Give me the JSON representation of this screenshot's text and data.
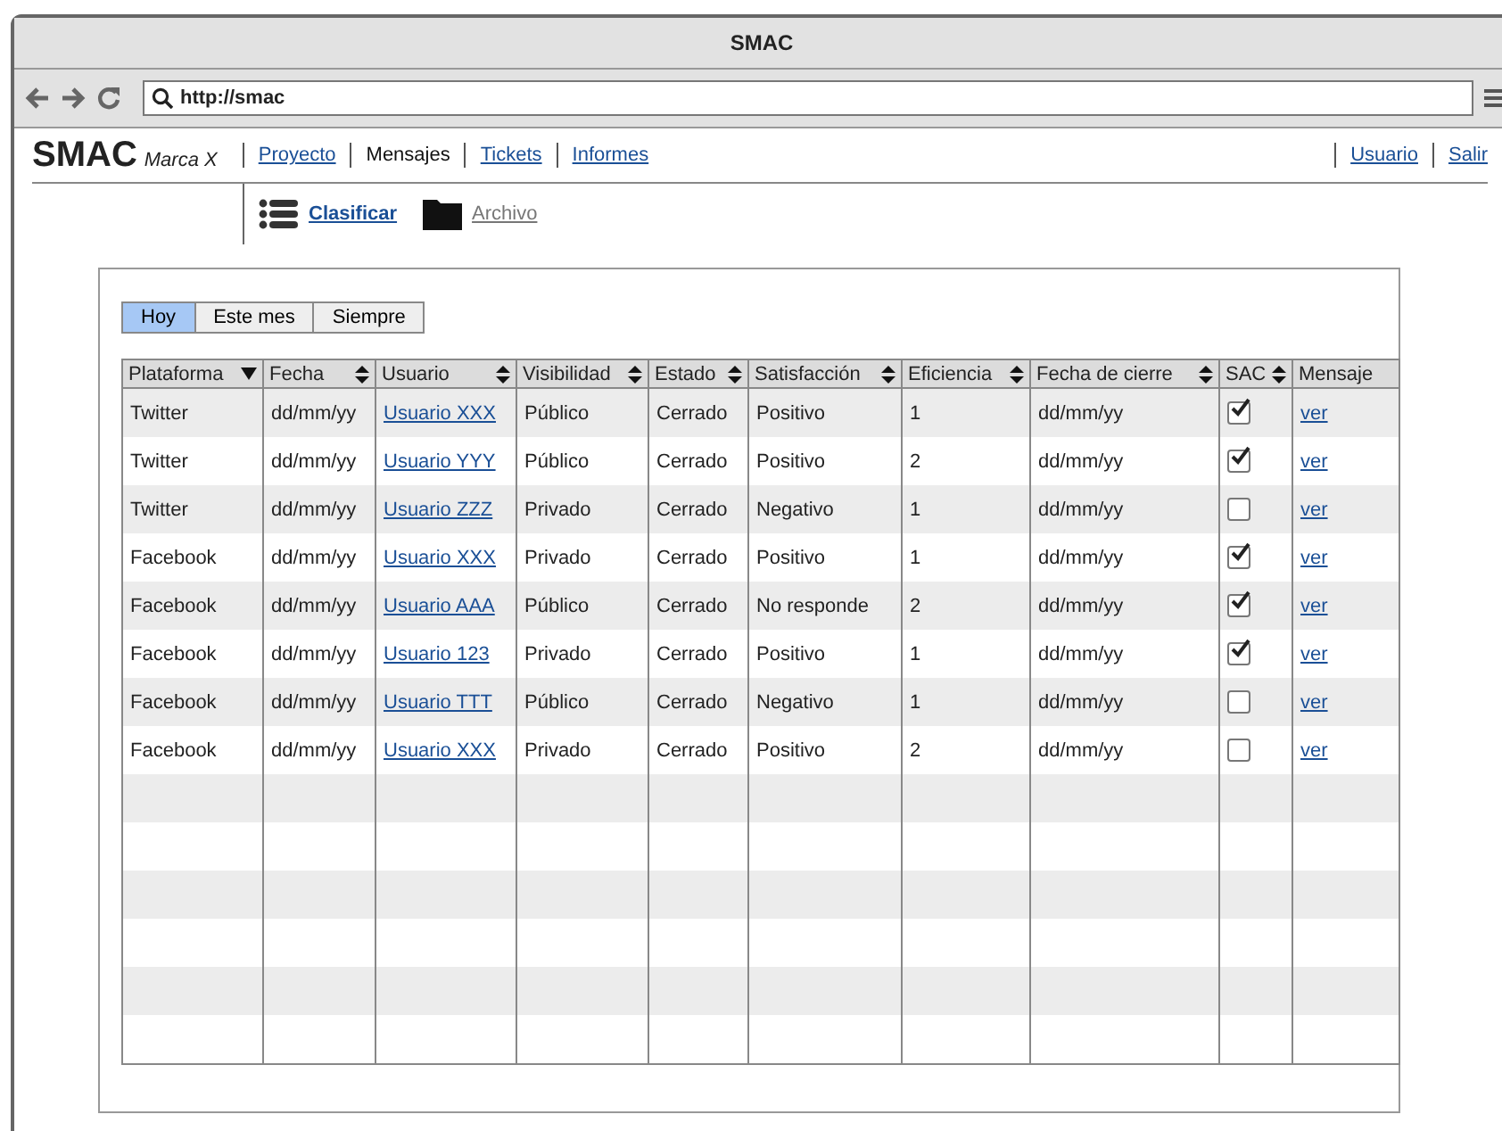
{
  "window": {
    "title": "SMAC"
  },
  "browser": {
    "url": "http://smac"
  },
  "header": {
    "logo": "SMAC",
    "brand": "Marca X",
    "nav": [
      {
        "label": "Proyecto",
        "selected": false
      },
      {
        "label": "Mensajes",
        "selected": true
      },
      {
        "label": "Tickets",
        "selected": false
      },
      {
        "label": "Informes",
        "selected": false
      }
    ],
    "user_links": [
      "Usuario",
      "Salir"
    ]
  },
  "subnav": [
    {
      "label": "Clasificar",
      "selected": true
    },
    {
      "label": "Archivo",
      "selected": false
    }
  ],
  "filters": [
    {
      "label": "Hoy",
      "selected": true
    },
    {
      "label": "Este mes",
      "selected": false
    },
    {
      "label": "Siempre",
      "selected": false
    }
  ],
  "table": {
    "columns": [
      {
        "label": "Plataforma",
        "kind": "sorted"
      },
      {
        "label": "Fecha",
        "kind": "sortable"
      },
      {
        "label": "Usuario",
        "kind": "sortable"
      },
      {
        "label": "Visibilidad",
        "kind": "sortable"
      },
      {
        "label": "Estado",
        "kind": "sortable"
      },
      {
        "label": "Satisfacción",
        "kind": "sortable"
      },
      {
        "label": "Eficiencia",
        "kind": "sortable"
      },
      {
        "label": "Fecha de cierre",
        "kind": "sortable"
      },
      {
        "label": "SAC",
        "kind": "sortable"
      },
      {
        "label": "Mensaje",
        "kind": "plain"
      }
    ],
    "rows": [
      {
        "platform": "Twitter",
        "date": "dd/mm/yy",
        "user": "Usuario XXX",
        "visibility": "Público",
        "status": "Cerrado",
        "satisfaction": "Positivo",
        "efficiency": "1",
        "close_date": "dd/mm/yy",
        "sac": true,
        "message": "ver"
      },
      {
        "platform": "Twitter",
        "date": "dd/mm/yy",
        "user": "Usuario YYY",
        "visibility": "Público",
        "status": "Cerrado",
        "satisfaction": "Positivo",
        "efficiency": "2",
        "close_date": "dd/mm/yy",
        "sac": true,
        "message": "ver"
      },
      {
        "platform": "Twitter",
        "date": "dd/mm/yy",
        "user": "Usuario ZZZ",
        "visibility": "Privado",
        "status": "Cerrado",
        "satisfaction": "Negativo",
        "efficiency": "1",
        "close_date": "dd/mm/yy",
        "sac": false,
        "message": "ver"
      },
      {
        "platform": "Facebook",
        "date": "dd/mm/yy",
        "user": "Usuario XXX",
        "visibility": "Privado",
        "status": "Cerrado",
        "satisfaction": "Positivo",
        "efficiency": "1",
        "close_date": "dd/mm/yy",
        "sac": true,
        "message": "ver"
      },
      {
        "platform": "Facebook",
        "date": "dd/mm/yy",
        "user": "Usuario AAA",
        "visibility": "Público",
        "status": "Cerrado",
        "satisfaction": "No responde",
        "efficiency": "2",
        "close_date": "dd/mm/yy",
        "sac": true,
        "message": "ver"
      },
      {
        "platform": "Facebook",
        "date": "dd/mm/yy",
        "user": "Usuario 123",
        "visibility": "Privado",
        "status": "Cerrado",
        "satisfaction": "Positivo",
        "efficiency": "1",
        "close_date": "dd/mm/yy",
        "sac": true,
        "message": "ver"
      },
      {
        "platform": "Facebook",
        "date": "dd/mm/yy",
        "user": "Usuario TTT",
        "visibility": "Público",
        "status": "Cerrado",
        "satisfaction": "Negativo",
        "efficiency": "1",
        "close_date": "dd/mm/yy",
        "sac": false,
        "message": "ver"
      },
      {
        "platform": "Facebook",
        "date": "dd/mm/yy",
        "user": "Usuario XXX",
        "visibility": "Privado",
        "status": "Cerrado",
        "satisfaction": "Positivo",
        "efficiency": "2",
        "close_date": "dd/mm/yy",
        "sac": false,
        "message": "ver"
      }
    ]
  }
}
